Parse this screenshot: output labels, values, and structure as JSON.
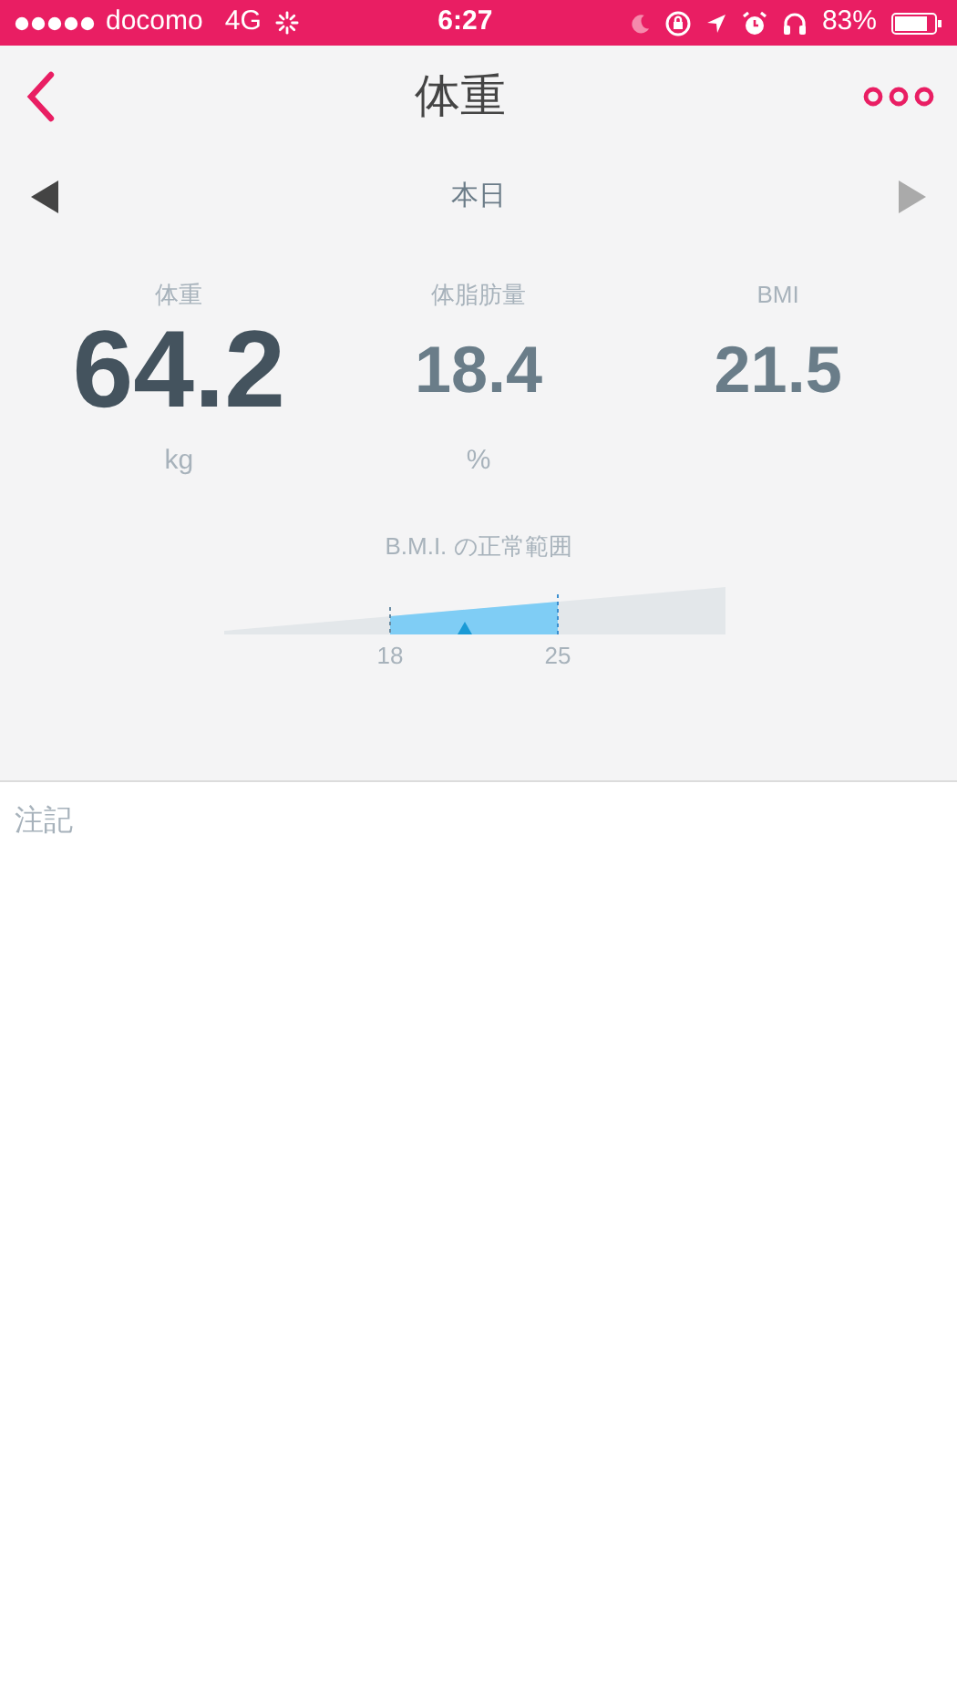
{
  "status_bar": {
    "carrier": "docomo",
    "network": "4G",
    "time": "6:27",
    "battery": "83%"
  },
  "header": {
    "title": "体重"
  },
  "date_nav": {
    "label": "本日"
  },
  "stats": [
    {
      "label": "体重",
      "value": "64.2",
      "unit": "kg",
      "primary": true
    },
    {
      "label": "体脂肪量",
      "value": "18.4",
      "unit": "%",
      "primary": false
    },
    {
      "label": "BMI",
      "value": "21.5",
      "primary": false
    }
  ],
  "bmi_gauge": {
    "title": "B.M.I. の正常範囲",
    "low": "18",
    "high": "25",
    "level": 0.48
  },
  "notes": {
    "placeholder": "注記"
  }
}
